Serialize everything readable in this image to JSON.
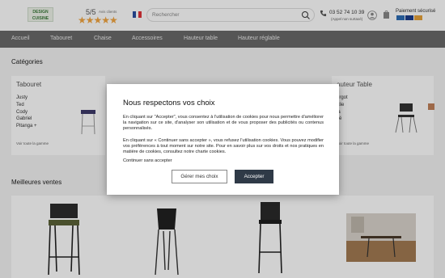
{
  "header": {
    "logo_text": "DESIGN CUISINE",
    "rating": "5/5",
    "rating_sub": "Avis clients",
    "stars": "★★★★★",
    "search_placeholder": "Rechercher",
    "phone": "03 52 74 10 39",
    "phone_sub": "(Appel non surtaxé)",
    "payment_label": "Paiement sécurisé"
  },
  "nav": {
    "items": [
      "Accueil",
      "Tabouret",
      "Chaise",
      "Accessoires",
      "Hauteur table",
      "Hauteur réglable"
    ]
  },
  "categories": {
    "title": "Catégories",
    "cards": [
      {
        "title": "Tabouret",
        "items": [
          "Justy",
          "Ted",
          "Cody",
          "Gabriel",
          "Pitanga +"
        ],
        "more": "Voir toute la gamme"
      },
      {
        "title": "auteur Table",
        "items": [
          "ergot",
          "alie",
          "",
          "ia",
          "cé"
        ],
        "more": "Voir toute la gamme"
      }
    ]
  },
  "best": {
    "title": "Meilleures ventes"
  },
  "cookie": {
    "title": "Nous respectons vos choix",
    "p1": "En cliquant sur \"Accepter\", vous consentez à l'utilisation de cookies pour nous permettre d'améliorer la navigation sur ce site, d'analyser son utilisation et de vous proposer des publicités ou contenus personnalisés.",
    "p2": "En cliquant sur « Continuer sans accepter », vous refusez l'utilisation cookies. Vous pouvez modifier vos préférences à tout moment sur notre site. Pour en savoir plus sur vos droits et nos pratiques en matière de cookies, consultez notre charte cookies.",
    "continue_link": "Continuer sans accepter",
    "manage_btn": "Gérer mes choix",
    "accept_btn": "Accepter"
  },
  "colors": {
    "nav_bg": "#6a6a6a",
    "accept_bg": "#2f3a47",
    "star": "#f2a541"
  }
}
